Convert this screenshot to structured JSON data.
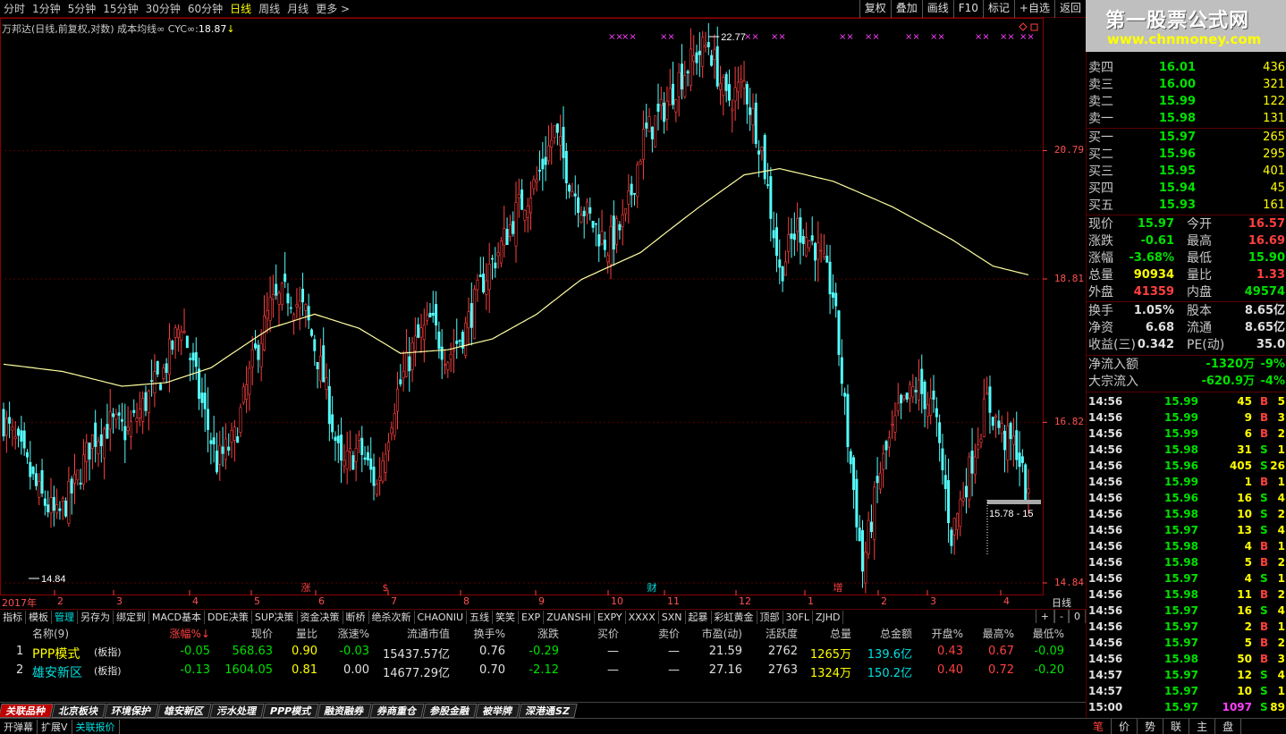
{
  "periods": [
    {
      "label": "分时"
    },
    {
      "label": "1分钟"
    },
    {
      "label": "5分钟"
    },
    {
      "label": "15分钟"
    },
    {
      "label": "30分钟"
    },
    {
      "label": "60分钟"
    },
    {
      "label": "日线",
      "active": true
    },
    {
      "label": "周线"
    },
    {
      "label": "月线"
    },
    {
      "label": "更多 >"
    }
  ],
  "tools": [
    "复权",
    "叠加",
    "画线",
    "F10",
    "标记",
    "+自选",
    "返回"
  ],
  "logo": {
    "title": "第一股票公式网",
    "url": "www.chnmoney.com"
  },
  "chart_info": {
    "prefix": "万邦达(日线,前复权,对数) 成本均线∞ CYC∞:",
    "value": "18.87",
    "arrow": "↓"
  },
  "chart_data": {
    "type": "candlestick",
    "ylim": [
      14.84,
      22.77
    ],
    "y_ticks": [
      "20.79",
      "18.81",
      "16.82",
      "14.84"
    ],
    "max_label": "22.77",
    "min_label": "14.84",
    "last_price_label": "15.78 - 15",
    "x_labels": [
      "2017年",
      "2",
      "3",
      "4",
      "5",
      "6",
      "7",
      "8",
      "9",
      "10",
      "11",
      "12",
      "1",
      "2",
      "3",
      "4"
    ],
    "period_label": "日线",
    "events": [
      {
        "label": "涨",
        "color": "#ff4040"
      },
      {
        "label": "$",
        "color": "#ff4040"
      },
      {
        "label": "财",
        "color": "#00e0e0"
      },
      {
        "label": "增",
        "color": "#ff4040"
      }
    ],
    "anchors": [
      [
        0,
        16.85
      ],
      [
        6,
        16.4
      ],
      [
        12,
        15.9
      ],
      [
        18,
        15.6
      ],
      [
        24,
        16.0
      ],
      [
        30,
        16.6
      ],
      [
        36,
        16.8
      ],
      [
        42,
        16.7
      ],
      [
        48,
        17.1
      ],
      [
        54,
        17.5
      ],
      [
        60,
        18.2
      ],
      [
        66,
        17.2
      ],
      [
        72,
        16.3
      ],
      [
        78,
        16.6
      ],
      [
        84,
        17.6
      ],
      [
        90,
        18.4
      ],
      [
        96,
        18.6
      ],
      [
        102,
        18.3
      ],
      [
        108,
        17.4
      ],
      [
        114,
        16.2
      ],
      [
        120,
        16.5
      ],
      [
        126,
        16.0
      ],
      [
        132,
        17.1
      ],
      [
        138,
        17.8
      ],
      [
        144,
        18.2
      ],
      [
        150,
        17.7
      ],
      [
        156,
        18.1
      ],
      [
        162,
        18.8
      ],
      [
        168,
        19.3
      ],
      [
        174,
        19.9
      ],
      [
        180,
        20.3
      ],
      [
        186,
        21.1
      ],
      [
        192,
        20.2
      ],
      [
        198,
        19.7
      ],
      [
        204,
        19.3
      ],
      [
        210,
        19.7
      ],
      [
        216,
        21.0
      ],
      [
        222,
        21.4
      ],
      [
        228,
        22.0
      ],
      [
        234,
        22.4
      ],
      [
        238,
        22.6
      ],
      [
        244,
        21.6
      ],
      [
        250,
        21.9
      ],
      [
        256,
        20.8
      ],
      [
        262,
        18.9
      ],
      [
        268,
        19.6
      ],
      [
        274,
        19.3
      ],
      [
        280,
        18.6
      ],
      [
        285,
        16.6
      ],
      [
        290,
        15.0
      ],
      [
        296,
        16.2
      ],
      [
        302,
        16.9
      ],
      [
        308,
        17.3
      ],
      [
        314,
        17.0
      ],
      [
        320,
        15.4
      ],
      [
        326,
        16.2
      ],
      [
        332,
        17.1
      ],
      [
        338,
        16.6
      ],
      [
        342,
        16.5
      ],
      [
        346,
        15.78
      ]
    ],
    "ma_anchors": [
      [
        0,
        17.6
      ],
      [
        20,
        17.5
      ],
      [
        40,
        17.3
      ],
      [
        55,
        17.35
      ],
      [
        70,
        17.55
      ],
      [
        90,
        18.1
      ],
      [
        105,
        18.3
      ],
      [
        120,
        18.1
      ],
      [
        134,
        17.75
      ],
      [
        150,
        17.8
      ],
      [
        165,
        17.95
      ],
      [
        180,
        18.3
      ],
      [
        195,
        18.8
      ],
      [
        215,
        19.2
      ],
      [
        235,
        19.9
      ],
      [
        250,
        20.4
      ],
      [
        262,
        20.5
      ],
      [
        280,
        20.3
      ],
      [
        300,
        19.9
      ],
      [
        320,
        19.4
      ],
      [
        334,
        19.0
      ],
      [
        346,
        18.87
      ]
    ],
    "marker_positions": [
      [
        680,
        695
      ],
      [
        738,
        832
      ],
      [
        862,
        938
      ],
      [
        967,
        1012
      ],
      [
        1040
      ],
      [
        1090
      ],
      [
        1118,
        1140
      ]
    ]
  },
  "indicators": [
    {
      "label": "指标"
    },
    {
      "label": "模板"
    },
    {
      "label": "管理",
      "active": true
    },
    {
      "label": "另存为"
    },
    {
      "label": "绑定到"
    },
    {
      "label": "MACD基本"
    },
    {
      "label": "DDE决策"
    },
    {
      "label": "SUP决策"
    },
    {
      "label": "资金决策"
    },
    {
      "label": "断桥"
    },
    {
      "label": "绝杀次新"
    },
    {
      "label": "CHAONIU"
    },
    {
      "label": "五线"
    },
    {
      "label": "笑笑"
    },
    {
      "label": "EXP"
    },
    {
      "label": "ZUANSHI"
    },
    {
      "label": "EXPY"
    },
    {
      "label": "XXXX"
    },
    {
      "label": "SXN"
    },
    {
      "label": "起暴"
    },
    {
      "label": "彩虹黄金"
    },
    {
      "label": "顶部"
    },
    {
      "label": "30FL"
    },
    {
      "label": "ZJHD"
    }
  ],
  "ind_controls": [
    "+",
    "-",
    "0"
  ],
  "table": {
    "headers": [
      "名称(9)",
      "涨幅%↓",
      "现价",
      "量比",
      "涨速%",
      "流通市值",
      "换手%",
      "涨跌",
      "买价",
      "卖价",
      "市盈(动)",
      "活跃度",
      "总量",
      "总金额",
      "开盘%",
      "最高%",
      "最低%"
    ],
    "rows": [
      [
        "1",
        "PPP模式",
        "(板指)",
        "-0.05",
        "568.63",
        "0.90",
        "-0.03",
        "15437.57亿",
        "0.76",
        "-0.29",
        "—",
        "—",
        "21.59",
        "2762",
        "1265万",
        "139.6亿",
        "0.43",
        "0.67",
        "-0.09"
      ],
      [
        "2",
        "雄安新区",
        "(板指)",
        "-0.13",
        "1604.05",
        "0.81",
        "0.00",
        "14677.29亿",
        "0.70",
        "-2.12",
        "—",
        "—",
        "27.16",
        "2763",
        "1324万",
        "150.2亿",
        "0.40",
        "0.72",
        "-0.20"
      ]
    ]
  },
  "tabs": [
    {
      "label": "关联品种",
      "active": true
    },
    {
      "label": "北京板块"
    },
    {
      "label": "环境保护"
    },
    {
      "label": "雄安新区"
    },
    {
      "label": "污水处理"
    },
    {
      "label": "PPP模式"
    },
    {
      "label": "融资融券"
    },
    {
      "label": "券商重仓"
    },
    {
      "label": "参股金融"
    },
    {
      "label": "被举牌"
    },
    {
      "label": "深港通SZ"
    }
  ],
  "status": [
    {
      "label": "开弹幕"
    },
    {
      "label": "扩展V"
    },
    {
      "label": "关联报价",
      "active": true
    }
  ],
  "orderbook": {
    "asks": [
      [
        "卖四",
        "16.01",
        "436"
      ],
      [
        "卖三",
        "16.00",
        "321"
      ],
      [
        "卖二",
        "15.99",
        "122"
      ],
      [
        "卖一",
        "15.98",
        "131"
      ]
    ],
    "bids": [
      [
        "买一",
        "15.97",
        "265"
      ],
      [
        "买二",
        "15.96",
        "295"
      ],
      [
        "买三",
        "15.95",
        "401"
      ],
      [
        "买四",
        "15.94",
        "45"
      ],
      [
        "买五",
        "15.93",
        "161"
      ]
    ]
  },
  "quote": [
    [
      "现价",
      "15.97",
      "今开",
      "16.57",
      "g",
      "r"
    ],
    [
      "涨跌",
      "-0.61",
      "最高",
      "16.69",
      "g",
      "r"
    ],
    [
      "涨幅",
      "-3.68%",
      "最低",
      "15.90",
      "g",
      "g"
    ],
    [
      "总量",
      "90934",
      "量比",
      "1.33",
      "y",
      "r"
    ],
    [
      "外盘",
      "41359",
      "内盘",
      "49574",
      "r",
      "g"
    ]
  ],
  "stats": [
    [
      "换手",
      "1.05%",
      "股本",
      "8.65亿"
    ],
    [
      "净资",
      "6.68",
      "流通",
      "8.65亿"
    ],
    [
      "收益(三)",
      "0.342",
      "PE(动)",
      "35.0"
    ]
  ],
  "flow": [
    [
      "净流入额",
      "-1320万",
      "-9%"
    ],
    [
      "大宗流入",
      "-620.9万",
      "-4%"
    ]
  ],
  "ticks": [
    [
      "14:56",
      "15.99",
      "45",
      "B",
      "5"
    ],
    [
      "14:56",
      "15.99",
      "9",
      "B",
      "3"
    ],
    [
      "14:56",
      "15.99",
      "6",
      "B",
      "2"
    ],
    [
      "14:56",
      "15.98",
      "31",
      "S",
      "1"
    ],
    [
      "14:56",
      "15.96",
      "405",
      "S",
      "26"
    ],
    [
      "14:56",
      "15.99",
      "1",
      "B",
      "1"
    ],
    [
      "14:56",
      "15.96",
      "16",
      "S",
      "4"
    ],
    [
      "14:56",
      "15.98",
      "10",
      "S",
      "2"
    ],
    [
      "14:56",
      "15.97",
      "13",
      "S",
      "4"
    ],
    [
      "14:56",
      "15.98",
      "4",
      "B",
      "1"
    ],
    [
      "14:56",
      "15.98",
      "5",
      "B",
      "2"
    ],
    [
      "14:56",
      "15.97",
      "4",
      "S",
      "1"
    ],
    [
      "14:56",
      "15.98",
      "11",
      "B",
      "2"
    ],
    [
      "14:56",
      "15.97",
      "16",
      "S",
      "4"
    ],
    [
      "14:56",
      "15.97",
      "2",
      "B",
      "1"
    ],
    [
      "14:56",
      "15.97",
      "5",
      "B",
      "2"
    ],
    [
      "14:56",
      "15.98",
      "50",
      "B",
      "3"
    ],
    [
      "14:57",
      "15.97",
      "12",
      "S",
      "4"
    ],
    [
      "14:57",
      "15.97",
      "10",
      "S",
      "1"
    ],
    [
      "15:00",
      "15.97",
      "1097",
      "S",
      "89"
    ]
  ],
  "side_tabs": [
    "笔",
    "价",
    "势",
    "联",
    "主",
    "盘"
  ]
}
